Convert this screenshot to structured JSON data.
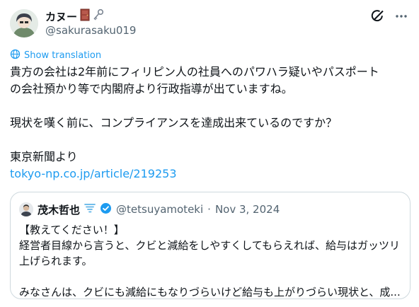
{
  "author": {
    "display_name": "カヌー",
    "handle": "@sakurasaku019"
  },
  "translate": {
    "label": "Show translation"
  },
  "tweet": {
    "line1": "貴方の会社は2年前にフィリピン人の社員へのパワハラ疑いやパスポート",
    "line2": "の会社預かり等で内閣府より行政指導が出ていますね。",
    "line3": "現状を嘆く前に、コンプライアンスを達成出来ているのですか？",
    "line4": "東京新聞より",
    "link": "tokyo-np.co.jp/article/219253"
  },
  "quote": {
    "display_name": "茂木哲也",
    "handle": "@tetsuyamoteki",
    "separator": "·",
    "date": "Nov 3, 2024",
    "line1": "【教えてください！】",
    "line2": "経営者目線から言うと、クビと減給をしやすくしてもらえれば、給与はガッツリ",
    "line3": "上げられます。",
    "line4": "みなさんは、クビにも減給にもなりづらいけど給与も上がりづらい現状と、成..."
  },
  "icons": {
    "author_badges": [
      "door-icon",
      "key-icon"
    ],
    "quote_badges": [
      "tornado-icon",
      "verified-badge-icon"
    ],
    "top_actions": [
      "grok-icon",
      "more-options-icon"
    ],
    "translate": "translate-globe-icon"
  },
  "colors": {
    "accent": "#1d9bf0",
    "text": "#0f1419",
    "muted": "#536471",
    "border": "#cfd9de",
    "door": "#a0453a"
  }
}
